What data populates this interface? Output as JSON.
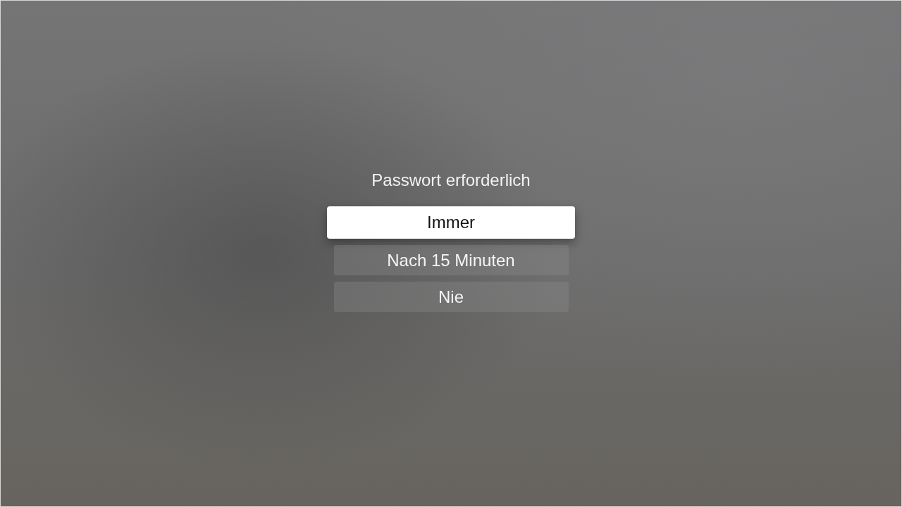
{
  "title": "Passwort erforderlich",
  "options": [
    {
      "label": "Immer",
      "selected": true
    },
    {
      "label": "Nach 15 Minuten",
      "selected": false
    },
    {
      "label": "Nie",
      "selected": false
    }
  ]
}
